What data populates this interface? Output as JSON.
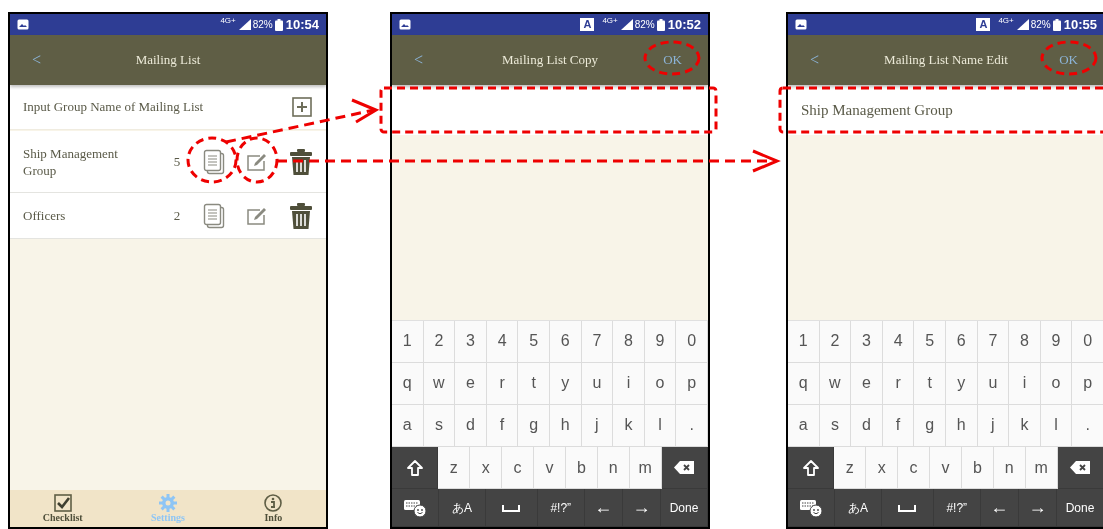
{
  "screens": [
    {
      "kind": "list",
      "status_bar": {
        "network": "4G+",
        "battery": "82%",
        "time": "10:54"
      },
      "app_bar": {
        "back": "<",
        "title": "Mailing List"
      },
      "add_row": {
        "label": "Input Group Name of Mailing List"
      },
      "groups": [
        {
          "name": "Ship Management Group",
          "count": "5"
        },
        {
          "name": "Officers",
          "count": "2"
        }
      ],
      "bottom_nav": [
        {
          "label": "Checklist",
          "selected": false
        },
        {
          "label": "Settings",
          "selected": true
        },
        {
          "label": "Info",
          "selected": false
        }
      ]
    },
    {
      "kind": "form",
      "status_bar": {
        "input_indicator": "A",
        "network": "4G+",
        "battery": "82%",
        "time": "10:52"
      },
      "app_bar": {
        "back": "<",
        "title": "Mailing List Copy",
        "action": "OK"
      },
      "keyboard": [
        [
          {
            "kind": "char",
            "label": "1"
          },
          {
            "kind": "char",
            "label": "2"
          },
          {
            "kind": "char",
            "label": "3"
          },
          {
            "kind": "char",
            "label": "4"
          },
          {
            "kind": "char",
            "label": "5"
          },
          {
            "kind": "char",
            "label": "6"
          },
          {
            "kind": "char",
            "label": "7"
          },
          {
            "kind": "char",
            "label": "8"
          },
          {
            "kind": "char",
            "label": "9"
          },
          {
            "kind": "char",
            "label": "0"
          }
        ],
        [
          {
            "kind": "char",
            "label": "q"
          },
          {
            "kind": "char",
            "label": "w"
          },
          {
            "kind": "char",
            "label": "e"
          },
          {
            "kind": "char",
            "label": "r"
          },
          {
            "kind": "char",
            "label": "t"
          },
          {
            "kind": "char",
            "label": "y"
          },
          {
            "kind": "char",
            "label": "u"
          },
          {
            "kind": "char",
            "label": "i"
          },
          {
            "kind": "char",
            "label": "o"
          },
          {
            "kind": "char",
            "label": "p"
          }
        ],
        [
          {
            "kind": "char",
            "label": "a"
          },
          {
            "kind": "char",
            "label": "s"
          },
          {
            "kind": "char",
            "label": "d"
          },
          {
            "kind": "char",
            "label": "f"
          },
          {
            "kind": "char",
            "label": "g"
          },
          {
            "kind": "char",
            "label": "h"
          },
          {
            "kind": "char",
            "label": "j"
          },
          {
            "kind": "char",
            "label": "k"
          },
          {
            "kind": "char",
            "label": "l"
          },
          {
            "kind": "char",
            "label": "."
          }
        ],
        [
          {
            "kind": "shift"
          },
          {
            "kind": "char",
            "label": "z"
          },
          {
            "kind": "char",
            "label": "x"
          },
          {
            "kind": "char",
            "label": "c"
          },
          {
            "kind": "char",
            "label": "v"
          },
          {
            "kind": "char",
            "label": "b"
          },
          {
            "kind": "char",
            "label": "n"
          },
          {
            "kind": "char",
            "label": "m"
          },
          {
            "kind": "backspace"
          }
        ],
        [
          {
            "kind": "emoji"
          },
          {
            "kind": "func",
            "label": "あA"
          },
          {
            "kind": "space"
          },
          {
            "kind": "func",
            "label": "#!?”"
          },
          {
            "kind": "nav",
            "label": "←"
          },
          {
            "kind": "nav",
            "label": "→"
          },
          {
            "kind": "func",
            "label": "Done"
          }
        ]
      ]
    },
    {
      "kind": "form",
      "status_bar": {
        "input_indicator": "A",
        "network": "4G+",
        "battery": "82%",
        "time": "10:55"
      },
      "app_bar": {
        "back": "<",
        "title": "Mailing List Name Edit",
        "action": "OK"
      },
      "name_field": {
        "value": "Ship Management Group"
      },
      "keyboard": [
        [
          {
            "kind": "char",
            "label": "1"
          },
          {
            "kind": "char",
            "label": "2"
          },
          {
            "kind": "char",
            "label": "3"
          },
          {
            "kind": "char",
            "label": "4"
          },
          {
            "kind": "char",
            "label": "5"
          },
          {
            "kind": "char",
            "label": "6"
          },
          {
            "kind": "char",
            "label": "7"
          },
          {
            "kind": "char",
            "label": "8"
          },
          {
            "kind": "char",
            "label": "9"
          },
          {
            "kind": "char",
            "label": "0"
          }
        ],
        [
          {
            "kind": "char",
            "label": "q"
          },
          {
            "kind": "char",
            "label": "w"
          },
          {
            "kind": "char",
            "label": "e"
          },
          {
            "kind": "char",
            "label": "r"
          },
          {
            "kind": "char",
            "label": "t"
          },
          {
            "kind": "char",
            "label": "y"
          },
          {
            "kind": "char",
            "label": "u"
          },
          {
            "kind": "char",
            "label": "i"
          },
          {
            "kind": "char",
            "label": "o"
          },
          {
            "kind": "char",
            "label": "p"
          }
        ],
        [
          {
            "kind": "char",
            "label": "a"
          },
          {
            "kind": "char",
            "label": "s"
          },
          {
            "kind": "char",
            "label": "d"
          },
          {
            "kind": "char",
            "label": "f"
          },
          {
            "kind": "char",
            "label": "g"
          },
          {
            "kind": "char",
            "label": "h"
          },
          {
            "kind": "char",
            "label": "j"
          },
          {
            "kind": "char",
            "label": "k"
          },
          {
            "kind": "char",
            "label": "l"
          },
          {
            "kind": "char",
            "label": "."
          }
        ],
        [
          {
            "kind": "shift"
          },
          {
            "kind": "char",
            "label": "z"
          },
          {
            "kind": "char",
            "label": "x"
          },
          {
            "kind": "char",
            "label": "c"
          },
          {
            "kind": "char",
            "label": "v"
          },
          {
            "kind": "char",
            "label": "b"
          },
          {
            "kind": "char",
            "label": "n"
          },
          {
            "kind": "char",
            "label": "m"
          },
          {
            "kind": "backspace"
          }
        ],
        [
          {
            "kind": "emoji"
          },
          {
            "kind": "func",
            "label": "あA"
          },
          {
            "kind": "space"
          },
          {
            "kind": "func",
            "label": "#!?”"
          },
          {
            "kind": "nav",
            "label": "←"
          },
          {
            "kind": "nav",
            "label": "→"
          },
          {
            "kind": "func",
            "label": "Done"
          }
        ]
      ]
    }
  ]
}
